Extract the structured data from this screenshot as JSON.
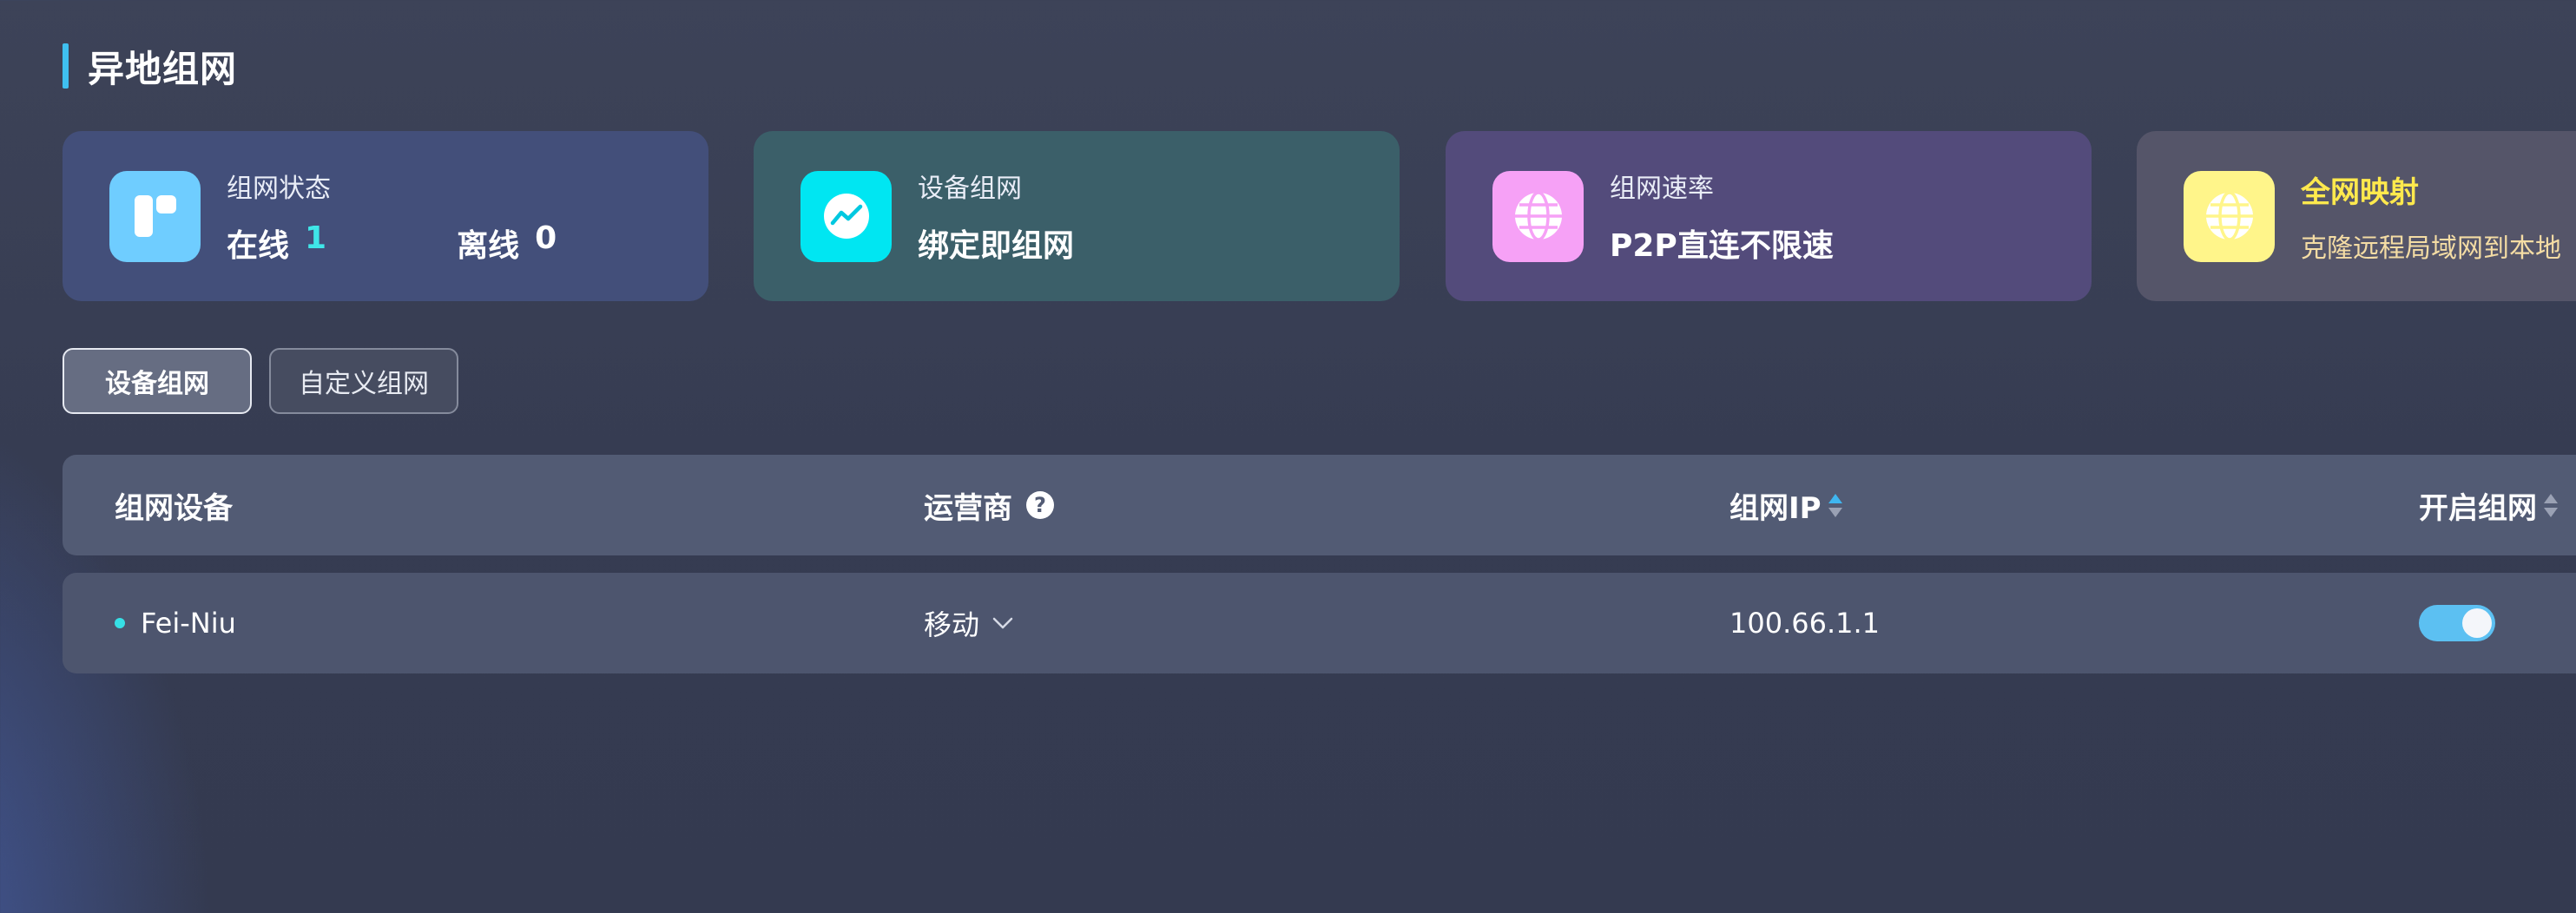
{
  "page": {
    "title": "异地组网"
  },
  "colors": {
    "accent": "#3fc0f0",
    "online": "#3fe6e8",
    "highlight_yellow": "#ffe94d"
  },
  "cards": [
    {
      "icon": "layout-icon",
      "label": "组网状态",
      "online_label": "在线",
      "online_count": "1",
      "offline_label": "离线",
      "offline_count": "0"
    },
    {
      "icon": "pulse-chart-icon",
      "label": "设备组网",
      "value": "绑定即组网"
    },
    {
      "icon": "globe-icon",
      "label": "组网速率",
      "value": "P2P直连不限速"
    },
    {
      "icon": "globe-network-icon",
      "label": "全网映射",
      "value": "克隆远程局域网到本地"
    }
  ],
  "tabs": [
    {
      "label": "设备组网",
      "active": true
    },
    {
      "label": "自定义组网",
      "active": false
    }
  ],
  "table": {
    "columns": [
      "组网设备",
      "运营商",
      "组网IP",
      "开启组网"
    ],
    "rows": [
      {
        "device": "Fei-Niu",
        "status": "online",
        "carrier": "移动",
        "ip": "100.66.1.1",
        "enabled": true
      }
    ]
  }
}
